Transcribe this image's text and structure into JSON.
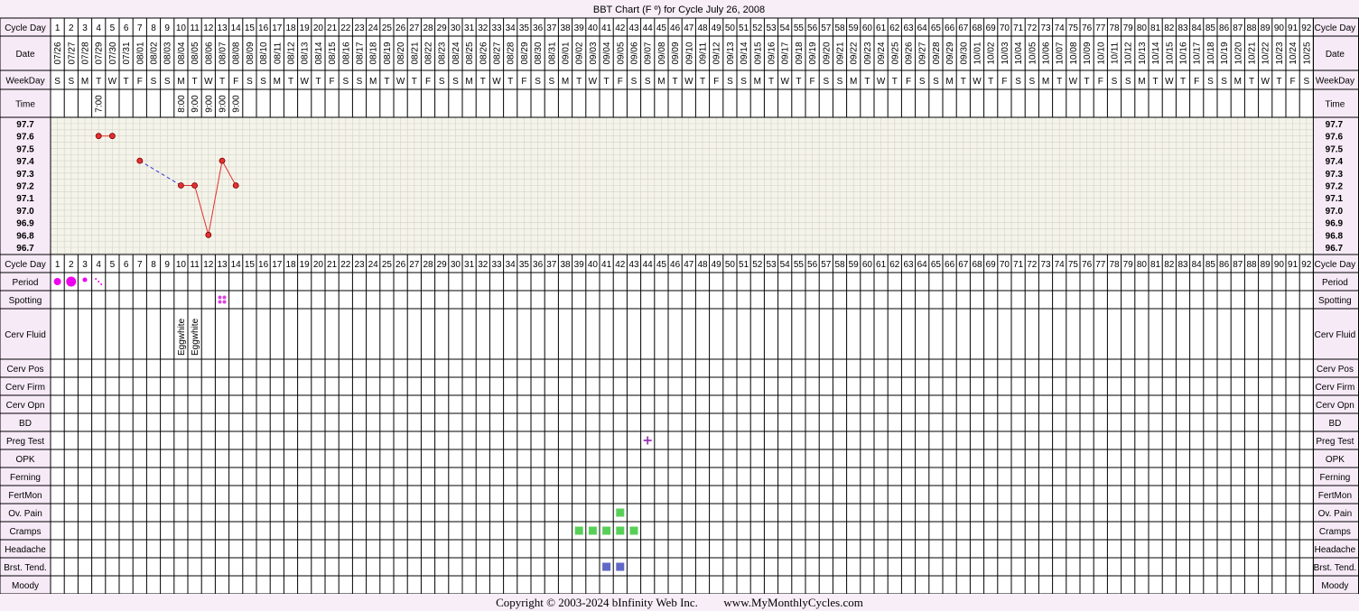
{
  "title": "BBT Chart (F º) for Cycle July 26, 2008",
  "copyright": "Copyright © 2003-2024 bInfinity Web Inc.",
  "website": "www.MyMonthlyCycles.com",
  "row_labels": {
    "cycle_day": "Cycle Day",
    "date": "Date",
    "weekday": "WeekDay",
    "time": "Time",
    "period": "Period",
    "spotting": "Spotting",
    "cerv_fluid": "Cerv Fluid",
    "cerv_pos": "Cerv Pos",
    "cerv_firm": "Cerv Firm",
    "cerv_opn": "Cerv Opn",
    "bd": "BD",
    "preg_test": "Preg Test",
    "opk": "OPK",
    "ferning": "Ferning",
    "fertmon": "FertMon",
    "ov_pain": "Ov. Pain",
    "cramps": "Cramps",
    "headache": "Headache",
    "brst_tend": "Brst. Tend.",
    "moody": "Moody"
  },
  "temp_scale": [
    "97.7",
    "97.6",
    "97.5",
    "97.4",
    "97.3",
    "97.2",
    "97.1",
    "97.0",
    "96.9",
    "96.8",
    "96.7"
  ],
  "days": {
    "count": 92,
    "first_date": "2008-07-26",
    "weekday_letters": [
      "S",
      "S",
      "M",
      "T",
      "W",
      "T",
      "F"
    ]
  },
  "chart_data": {
    "type": "line",
    "title": "BBT Chart (F º) for Cycle July 26, 2008",
    "xlabel": "Cycle Day",
    "ylabel": "",
    "ylim": [
      96.7,
      97.7
    ],
    "grid": true,
    "series": [
      {
        "x": [
          4,
          5,
          7,
          10,
          11,
          12,
          13,
          14
        ],
        "y": [
          97.6,
          97.6,
          97.4,
          97.2,
          97.2,
          96.8,
          97.4,
          97.2
        ],
        "connect": [
          "solid",
          "none",
          "dashed",
          "solid",
          "solid",
          "solid",
          "solid"
        ]
      }
    ],
    "times": [
      {
        "day": 4,
        "value": "7:00"
      },
      {
        "day": 10,
        "value": "8:00"
      },
      {
        "day": 11,
        "value": "9:00"
      },
      {
        "day": 12,
        "value": "9:00"
      },
      {
        "day": 13,
        "value": "9:00"
      },
      {
        "day": 14,
        "value": "9:00"
      }
    ],
    "period": [
      {
        "day": 1,
        "level": "medium"
      },
      {
        "day": 2,
        "level": "heavy"
      },
      {
        "day": 3,
        "level": "light"
      },
      {
        "day": 4,
        "level": "spotting"
      }
    ],
    "spotting": [
      13
    ],
    "cerv_fluid": [
      {
        "day": 10,
        "value": "Eggwhite"
      },
      {
        "day": 11,
        "value": "Eggwhite"
      }
    ],
    "preg_test": [
      {
        "day": 44,
        "result": "positive"
      }
    ],
    "ov_pain": [
      42
    ],
    "cramps": [
      39,
      40,
      41,
      42,
      43
    ],
    "brst_tend": [
      41,
      42
    ]
  },
  "colors": {
    "page_bg": "#f8eef8",
    "label_bg": "#f6eaf7",
    "grid_bg": "#f5f4ea",
    "grid_line": "#d2d2c8",
    "temp_line": "#e23030",
    "dash_line": "#3535dd",
    "point_fill": "#e23030",
    "period": "#ee00ee",
    "green": "#58d058",
    "blue": "#6268c6",
    "preg": "#9a33b8"
  }
}
